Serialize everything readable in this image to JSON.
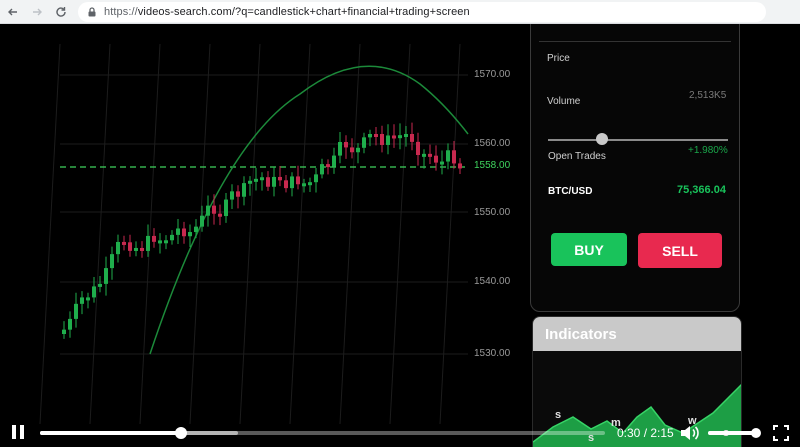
{
  "browser": {
    "url_scheme": "https://",
    "url_rest": "videos-search.com/?q=candlestick+chart+financial+trading+screen"
  },
  "chart": {
    "price_ticks": [
      "1570.00",
      "1560.00",
      "1558.00",
      "1550.00",
      "1540.00",
      "1530.00"
    ],
    "highlight_price_color": "#3fd45e",
    "up_color": "#1fae4c",
    "down_color": "#c8294f"
  },
  "panel": {
    "price_label": "Price",
    "volume_label": "Volume",
    "volume_value": "2,513K5",
    "open_trades_label": "Open Trades",
    "open_trades_value": "+1.980%",
    "pair_label": "BTC/USD",
    "pair_value": "75,366.04",
    "volume_slider_fraction": 0.3,
    "buy_label": "BUY",
    "sell_label": "SELL"
  },
  "indicators": {
    "title": "Indicators",
    "letters": [
      "s",
      "s",
      "m",
      "w",
      "s"
    ]
  },
  "player": {
    "time": "0:30 / 2:15",
    "progress_fraction": 0.25,
    "buffered_fraction": 0.35,
    "volume_fraction": 0.92,
    "play_state_icon": "pause-icon"
  }
}
